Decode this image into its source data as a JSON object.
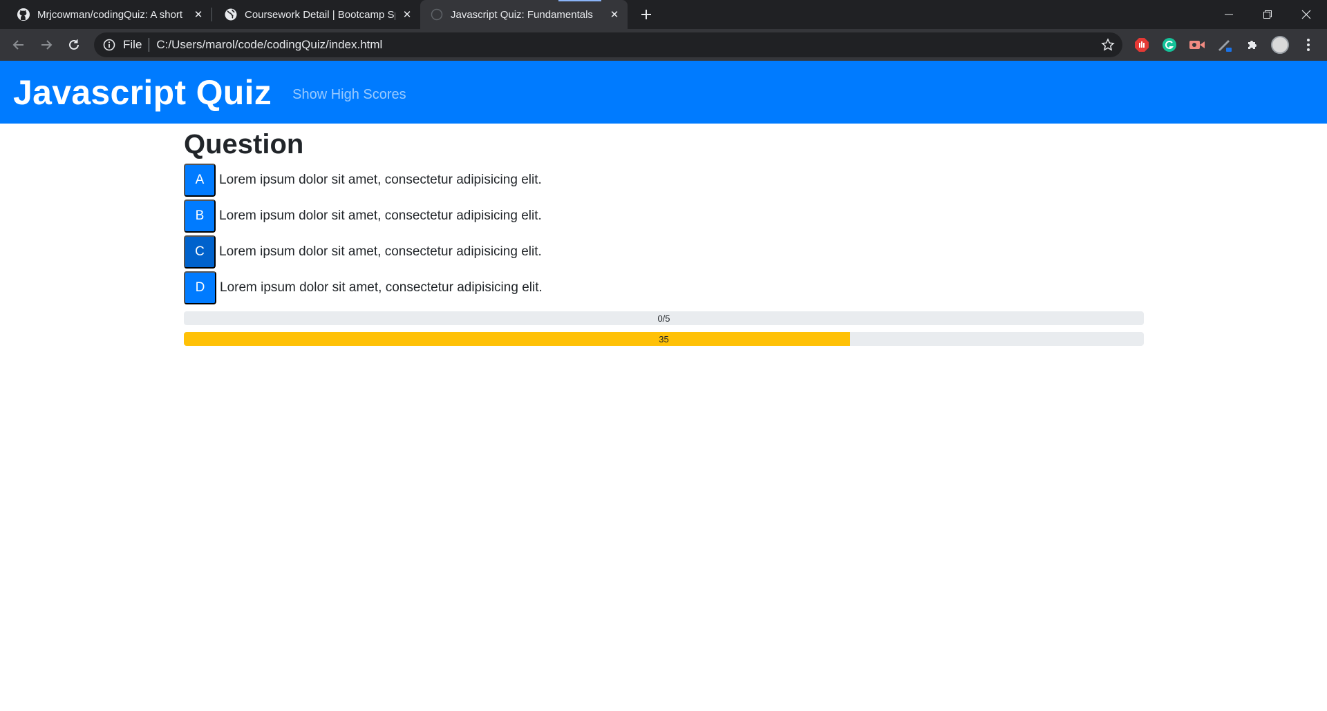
{
  "browser": {
    "tabs": [
      {
        "title": "Mrjcowman/codingQuiz: A short",
        "favicon": "github-icon"
      },
      {
        "title": "Coursework Detail | Bootcamp Sp",
        "favicon": "globe-icon"
      },
      {
        "title": "Javascript Quiz: Fundamentals",
        "favicon": "page-icon",
        "active": true
      }
    ],
    "address": {
      "scheme_label": "File",
      "url": "C:/Users/marol/code/codingQuiz/index.html"
    }
  },
  "page": {
    "brand": "Javascript Quiz",
    "nav_link": "Show High Scores",
    "question_title": "Question",
    "answers": [
      {
        "letter": "A",
        "text": "Lorem ipsum dolor sit amet, consectetur adipisicing elit."
      },
      {
        "letter": "B",
        "text": "Lorem ipsum dolor sit amet, consectetur adipisicing elit."
      },
      {
        "letter": "C",
        "text": "Lorem ipsum dolor sit amet, consectetur adipisicing elit."
      },
      {
        "letter": "D",
        "text": "Lorem ipsum dolor sit amet, consectetur adipisicing elit."
      }
    ],
    "score_label": "0/5",
    "score_fraction": 0,
    "timer_label": "35",
    "timer_fraction": 0.694,
    "colors": {
      "primary": "#007bff",
      "timer": "#ffc107",
      "track": "#e9ecef"
    }
  }
}
